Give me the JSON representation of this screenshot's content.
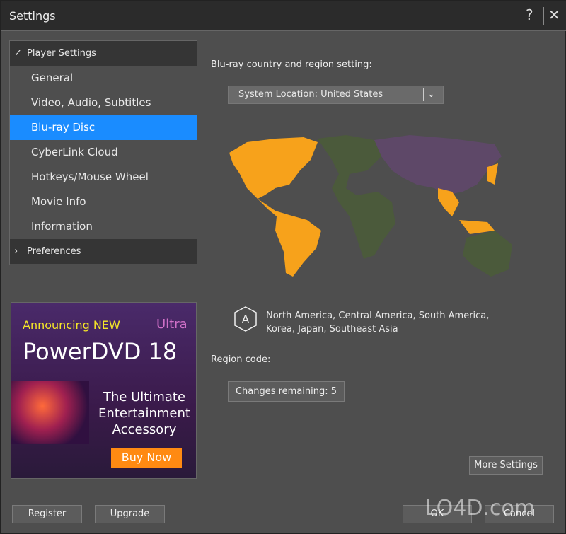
{
  "window": {
    "title": "Settings",
    "help": "?",
    "close": "✕"
  },
  "nav": {
    "group1": "Player Settings",
    "items": [
      "General",
      "Video, Audio, Subtitles",
      "Blu-ray Disc",
      "CyberLink Cloud",
      "Hotkeys/Mouse Wheel",
      "Movie Info",
      "Information"
    ],
    "selected": "Blu-ray Disc",
    "group2": "Preferences"
  },
  "ad": {
    "announcing": "Announcing NEW",
    "ultra": "Ultra",
    "product": "PowerDVD 18",
    "tagline": "The Ultimate Entertainment Accessory",
    "cta": "Buy Now"
  },
  "main": {
    "country_label": "Blu-ray country and region setting:",
    "location": "System Location: United States",
    "region_letter": "A",
    "region_desc": "North America, Central America, South America, Korea, Japan, Southeast Asia",
    "region_code_label": "Region code:",
    "changes": "Changes remaining: 5",
    "more_settings": "More Settings"
  },
  "colors": {
    "region_a": "#f7a21b",
    "region_b": "#4b5a3b",
    "region_c": "#5e4868",
    "selected": "#1a8cff"
  },
  "footer": {
    "register": "Register",
    "upgrade": "Upgrade",
    "ok": "OK",
    "cancel": "Cancel"
  },
  "watermark": "LO4D.com"
}
